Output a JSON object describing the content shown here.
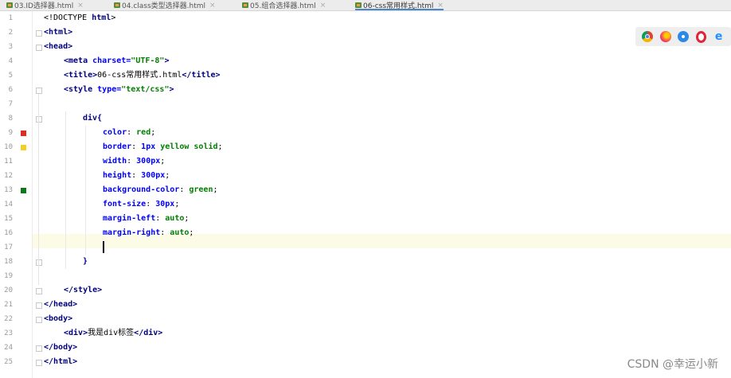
{
  "tabs": [
    {
      "label": "03.ID选择器.html"
    },
    {
      "label": "04.class类型选择器.html"
    },
    {
      "label": "05.组合选择器.html"
    },
    {
      "label": "06-css常用样式.html"
    }
  ],
  "line_numbers": [
    "1",
    "2",
    "3",
    "4",
    "5",
    "6",
    "7",
    "8",
    "9",
    "10",
    "11",
    "12",
    "13",
    "14",
    "15",
    "16",
    "17",
    "18",
    "19",
    "20",
    "21",
    "22",
    "23",
    "24",
    "25"
  ],
  "gutter_markers": {
    "line9": "#e02b20",
    "line10": "#f0d020",
    "line13": "#0a7a1a"
  },
  "code": {
    "l1": {
      "a": "<!DOCTYPE ",
      "b": "html",
      "c": ">"
    },
    "l2": {
      "a": "<html>"
    },
    "l3": {
      "a": "<head>"
    },
    "l4": {
      "a": "<meta ",
      "b": "charset=",
      "c": "\"UTF-8\"",
      "d": ">"
    },
    "l5": {
      "a": "<title>",
      "b": "06-css常用样式.html",
      "c": "</title>"
    },
    "l6": {
      "a": "<style ",
      "b": "type=",
      "c": "\"text/css\"",
      "d": ">"
    },
    "l7": {
      "a": ""
    },
    "l8": {
      "a": "div{"
    },
    "l9": {
      "a": "color",
      "b": ": ",
      "c": "red",
      "d": ";"
    },
    "l10": {
      "a": "border",
      "b": ": ",
      "c": "1px ",
      "d": "yellow solid",
      "e": ";"
    },
    "l11": {
      "a": "width",
      "b": ": ",
      "c": "300px",
      "d": ";"
    },
    "l12": {
      "a": "height",
      "b": ": ",
      "c": "300px",
      "d": ";"
    },
    "l13": {
      "a": "background-color",
      "b": ": ",
      "c": "green",
      "d": ";"
    },
    "l14": {
      "a": "font-size",
      "b": ": ",
      "c": "30px",
      "d": ";"
    },
    "l15": {
      "a": "margin-left",
      "b": ": ",
      "c": "auto",
      "d": ";"
    },
    "l16": {
      "a": "margin-right",
      "b": ": ",
      "c": "auto",
      "d": ";"
    },
    "l18": {
      "a": "}"
    },
    "l20": {
      "a": "</style>"
    },
    "l21": {
      "a": "</head>"
    },
    "l22": {
      "a": "<body>"
    },
    "l23": {
      "a": "<div>",
      "b": "我是div标签",
      "c": "</div>"
    },
    "l24": {
      "a": "</body>"
    },
    "l25": {
      "a": "</html>"
    }
  },
  "browsers": [
    "chrome-icon",
    "firefox-icon",
    "safari-icon",
    "opera-icon",
    "ie-icon"
  ],
  "ie_glyph": "e",
  "watermark": "CSDN @幸运小新"
}
